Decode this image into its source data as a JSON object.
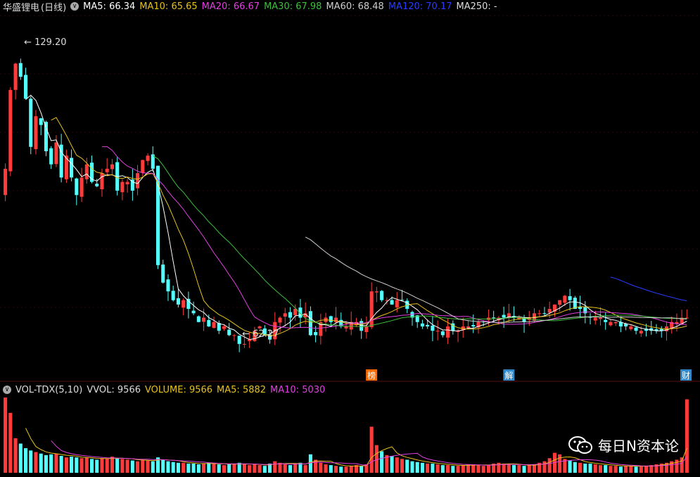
{
  "header": {
    "stock_name": "华盛锂电",
    "period": "(日线)",
    "ma_items": [
      {
        "label": "MA5: 66.34",
        "color": "#ffffff"
      },
      {
        "label": "MA10: 65.65",
        "color": "#e6c21a"
      },
      {
        "label": "MA20: 66.67",
        "color": "#e040e0"
      },
      {
        "label": "MA30: 67.98",
        "color": "#3cbf3c"
      },
      {
        "label": "MA60: 68.48",
        "color": "#cfcfcf"
      },
      {
        "label": "MA120: 70.17",
        "color": "#2a3cff"
      },
      {
        "label": "MA250: -",
        "color": "#dddddd"
      }
    ]
  },
  "sub_header": {
    "indicator": "VOL-TDX(5,10)",
    "items": [
      {
        "label": "VVOL: 9566",
        "color": "#dddddd"
      },
      {
        "label": "VOLUME: 9566",
        "color": "#e6c21a"
      },
      {
        "label": "MA5: 5882",
        "color": "#e6c21a"
      },
      {
        "label": "MA10: 5030",
        "color": "#e040e0"
      }
    ]
  },
  "watermark": {
    "text": "每日N资本论",
    "icon": "wechat-icon"
  },
  "annotations": {
    "high": "129.20",
    "low": "62.27"
  },
  "markers": [
    {
      "text": "榜",
      "color": "#ff6a00",
      "index": 72
    },
    {
      "text": "解",
      "color": "#2f86c8",
      "index": 99
    },
    {
      "text": "财",
      "color": "#2f86c8",
      "index": 134
    }
  ],
  "colors": {
    "up": "#ff3b3b",
    "down": "#54ffff",
    "grid": "#5a1010"
  },
  "chart_data": {
    "type": "candlestick",
    "title": "华盛锂电 (日线)",
    "ylim": [
      55,
      135
    ],
    "high": 129.2,
    "low": 62.27,
    "close_series": [
      100,
      118,
      124,
      121,
      116,
      105,
      112,
      110,
      104,
      101,
      106,
      98,
      103,
      98,
      94,
      98,
      101,
      97,
      96,
      99,
      100,
      101,
      95,
      97,
      97,
      95,
      99,
      102,
      103,
      100,
      78,
      74,
      72,
      70,
      69,
      70,
      68,
      67,
      65,
      66,
      64,
      65,
      63,
      64,
      62,
      62,
      60,
      60,
      61,
      63,
      64,
      62,
      61,
      65,
      66,
      67,
      66,
      68,
      66,
      67,
      62,
      62,
      65,
      66,
      65,
      66,
      64,
      64,
      65,
      65,
      63,
      64,
      72,
      72,
      70,
      70,
      69,
      70,
      70,
      68,
      66,
      65,
      64,
      64,
      63,
      63,
      62,
      64,
      63,
      63,
      64,
      64,
      64,
      65,
      65,
      66,
      66,
      66,
      66,
      67,
      66,
      66,
      65,
      66,
      67,
      67,
      67,
      68,
      69,
      70,
      71,
      70,
      68,
      68,
      67,
      66,
      66,
      66,
      65,
      65,
      65,
      64,
      64,
      64,
      63,
      63,
      63,
      63,
      63,
      63,
      64,
      65,
      65,
      66,
      66
    ],
    "volume_series": [
      9800,
      7800,
      4500,
      3800,
      3200,
      2900,
      2700,
      2500,
      2300,
      2400,
      2500,
      2200,
      2000,
      2100,
      2000,
      1900,
      2000,
      1800,
      1700,
      1900,
      1800,
      2100,
      1900,
      1800,
      1700,
      1600,
      1500,
      1700,
      1600,
      1500,
      2000,
      1700,
      1500,
      1400,
      1300,
      1300,
      1200,
      1200,
      1100,
      1200,
      1300,
      1200,
      1100,
      1000,
      1100,
      1200,
      1300,
      1100,
      1000,
      1100,
      1000,
      900,
      1200,
      1500,
      1300,
      1100,
      1000,
      1200,
      1300,
      1000,
      2400,
      1700,
      1300,
      1100,
      1000,
      900,
      800,
      800,
      900,
      1000,
      900,
      1100,
      6000,
      3600,
      2800,
      2300,
      2200,
      2000,
      1800,
      1700,
      1500,
      1400,
      1300,
      1200,
      1200,
      1100,
      1000,
      1000,
      900,
      900,
      1000,
      1100,
      1100,
      1000,
      900,
      1000,
      1200,
      1300,
      1200,
      1100,
      1000,
      1000,
      900,
      1000,
      1100,
      1300,
      1500,
      1900,
      2600,
      2400,
      1800,
      1600,
      1400,
      1300,
      1200,
      1200,
      1100,
      1000,
      1000,
      900,
      900,
      800,
      900,
      900,
      800,
      800,
      900,
      1000,
      1100,
      1200,
      1300,
      1500,
      1700,
      2000,
      9566
    ]
  }
}
